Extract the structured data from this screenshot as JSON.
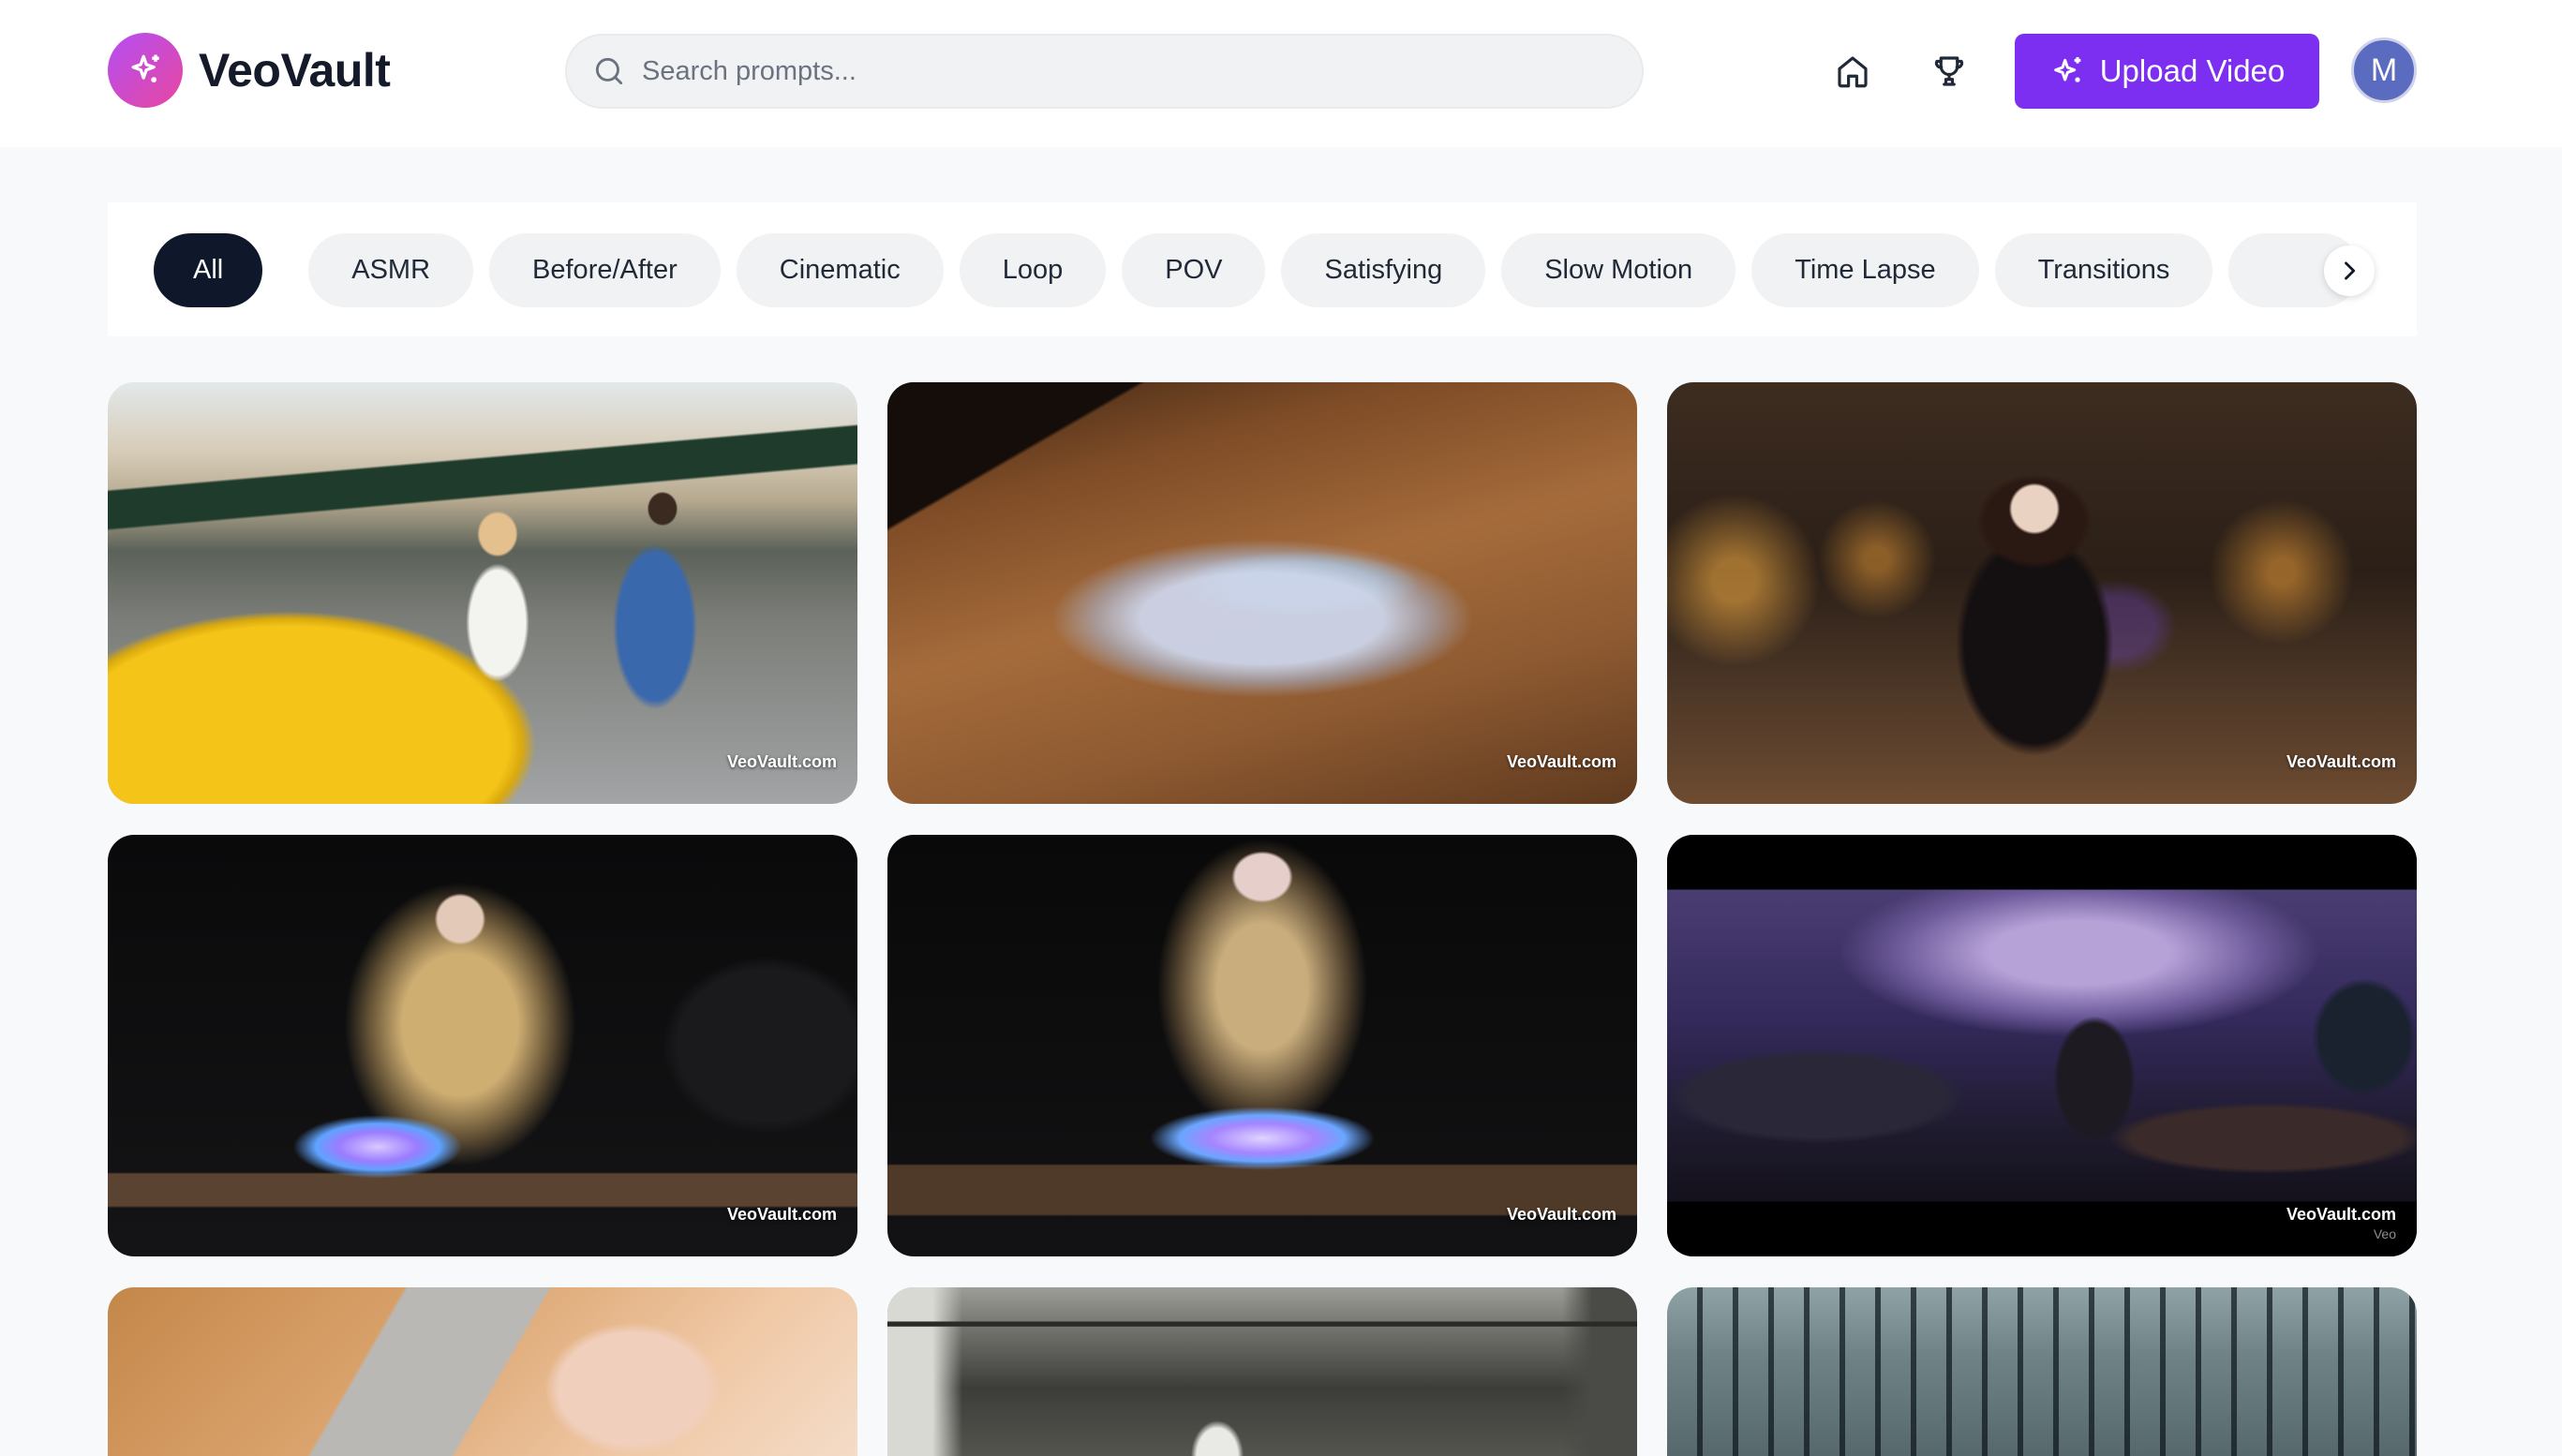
{
  "colors": {
    "accent": "#7c2ff0",
    "active_pill": "#0f172a",
    "pill_bg": "#f1f2f4",
    "page_bg": "#f8f9fb",
    "avatar": "#5b6bbf"
  },
  "brand": {
    "name": "VeoVault",
    "logo_icon": "sparkles-icon"
  },
  "search": {
    "placeholder": "Search prompts...",
    "icon": "search-icon"
  },
  "nav": {
    "home_icon": "home-icon",
    "trophy_icon": "trophy-icon"
  },
  "upload_button": {
    "label": "Upload Video",
    "icon": "sparkles-icon"
  },
  "user": {
    "avatar_initial": "M"
  },
  "categories": {
    "scroll_icon": "chevron-right-icon",
    "items": [
      {
        "label": "All",
        "active": true
      },
      {
        "label": "ASMR",
        "active": false
      },
      {
        "label": "Before/After",
        "active": false
      },
      {
        "label": "Cinematic",
        "active": false
      },
      {
        "label": "Loop",
        "active": false
      },
      {
        "label": "POV",
        "active": false
      },
      {
        "label": "Satisfying",
        "active": false
      },
      {
        "label": "Slow Motion",
        "active": false
      },
      {
        "label": "Time Lapse",
        "active": false
      },
      {
        "label": "Transitions",
        "active": false
      }
    ]
  },
  "videos": [
    {
      "watermark": "VeoVault.com"
    },
    {
      "watermark": "VeoVault.com"
    },
    {
      "watermark": "VeoVault.com"
    },
    {
      "watermark": "VeoVault.com"
    },
    {
      "watermark": "VeoVault.com"
    },
    {
      "watermark": "VeoVault.com",
      "sub_watermark": "Veo"
    },
    {},
    {},
    {}
  ]
}
